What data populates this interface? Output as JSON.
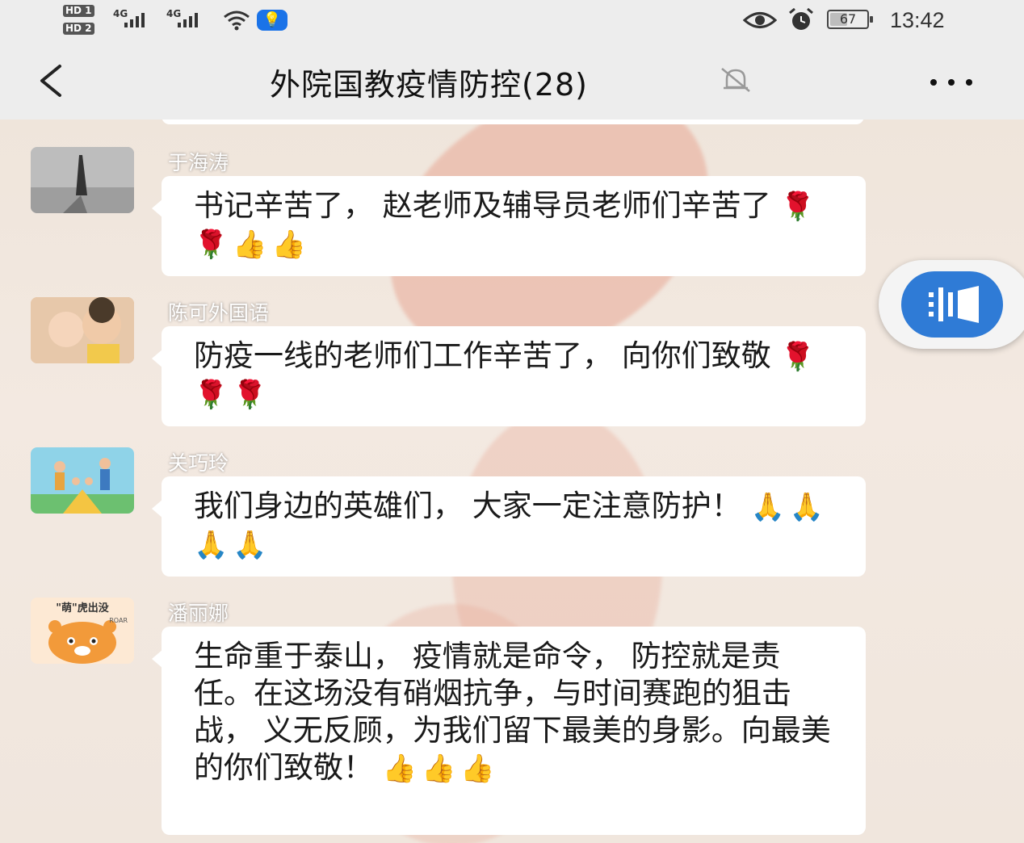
{
  "status_bar": {
    "hd1": "HD 1",
    "hd2": "HD 2",
    "net1": "4G",
    "net2": "4G",
    "battery": "67",
    "time": "13:42",
    "icons": [
      "signal-icon",
      "wifi-icon",
      "bulb-icon",
      "eye-icon",
      "alarm-icon",
      "battery-icon"
    ]
  },
  "header": {
    "title": "外院国教疫情防控(28)",
    "icons": [
      "back-icon",
      "mute-icon",
      "more-icon"
    ]
  },
  "messages": [
    {
      "sender": "于海涛",
      "text": "书记辛苦了，  赵老师及辅导员老师们辛苦了",
      "emoji": "🌹🌹👍👍"
    },
    {
      "sender": "陈可外国语",
      "text": "防疫一线的老师们工作辛苦了，  向你们致敬",
      "emoji": "🌹🌹🌹"
    },
    {
      "sender": "关巧玲",
      "text": "我们身边的英雄们，  大家一定注意防护！",
      "emoji": "🙏🙏🙏🙏"
    },
    {
      "sender": "潘丽娜",
      "text": "生命重于泰山，  疫情就是命令，  防控就是责任。在这场没有硝烟抗争，与时间赛跑的狙击战，  义无反顾，为我们留下最美的身影。向最美的你们致敬！",
      "emoji": "👍👍👍",
      "avatar_caption": "\"萌\"虎出没",
      "avatar_small": "ROAR"
    }
  ],
  "colors": {
    "header_bg": "#ededed",
    "bubble_bg": "#ffffff",
    "float_button": "#2f7bd6"
  }
}
